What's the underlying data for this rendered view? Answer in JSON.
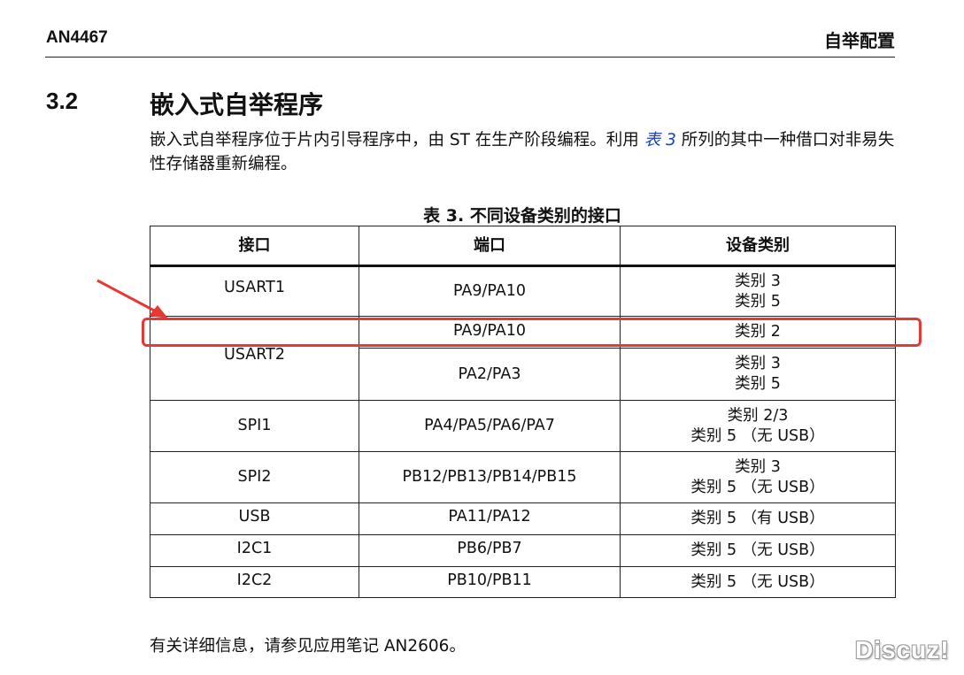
{
  "header": {
    "doc_id": "AN4467",
    "section_label": "自举配置"
  },
  "section": {
    "number": "3.2",
    "title": "嵌入式自举程序"
  },
  "paragraph": {
    "before": "嵌入式自举程序位于片内引导程序中，由 ST 在生产阶段编程。利用 ",
    "ref": "表 3",
    "after": " 所列的其中一种借口对非易失性存储器重新编程。"
  },
  "table": {
    "caption": "表 3. 不同设备类别的接口",
    "headers": [
      "接口",
      "端口",
      "设备类别"
    ],
    "rows": [
      {
        "iface": "USART1",
        "port": "PA9/PA10",
        "cat1": "类别 3",
        "cat2": "类别 5"
      },
      {
        "iface": "USART2",
        "port_a": "PA9/PA10",
        "cat_a": "类别 2",
        "port_b": "PA2/PA3",
        "cat_b1": "类别 3",
        "cat_b2": "类别 5"
      },
      {
        "iface": "SPI1",
        "port": "PA4/PA5/PA6/PA7",
        "cat1": "类别 2/3",
        "cat2": "类别 5 （无 USB）"
      },
      {
        "iface": "SPI2",
        "port": "PB12/PB13/PB14/PB15",
        "cat1": "类别 3",
        "cat2": "类别 5 （无 USB）"
      },
      {
        "iface": "USB",
        "port": "PA11/PA12",
        "cat1": "类别 5 （有 USB）"
      },
      {
        "iface": "I2C1",
        "port": "PB6/PB7",
        "cat1": "类别 5 （无 USB）"
      },
      {
        "iface": "I2C2",
        "port": "PB10/PB11",
        "cat1": "类别 5 （无 USB）"
      }
    ]
  },
  "footer_text": "有关详细信息，请参见应用笔记 AN2606。",
  "watermark": "Discuz!",
  "colors": {
    "annotation": "#e53935",
    "link": "#1f3fbf"
  }
}
